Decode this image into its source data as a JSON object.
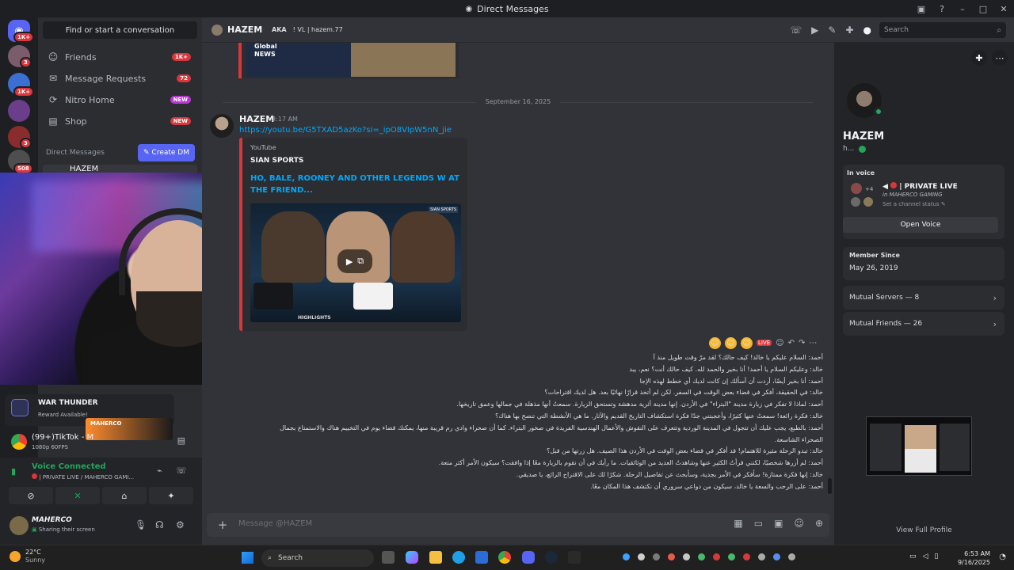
{
  "window": {
    "title": "Direct Messages"
  },
  "rail": {
    "badges": [
      "1K+",
      "3",
      "1K+",
      "3",
      "3",
      "508"
    ]
  },
  "sidebar": {
    "find_label": "Find or start a conversation",
    "items": [
      {
        "label": "Friends",
        "badge": "1K+"
      },
      {
        "label": "Message Requests",
        "badge": "72"
      },
      {
        "label": "Nitro Home",
        "badge": "NEW"
      },
      {
        "label": "Shop",
        "badge": "NEW"
      }
    ],
    "dm_header": "Direct Messages",
    "create_dm": "Create DM",
    "first_dm": "HAZEM"
  },
  "activity": {
    "game": "WAR THUNDER",
    "sub": "Reward Available!"
  },
  "tiktok": {
    "title": "(99+)TikTok - M",
    "sub": "1080p 60FPS",
    "overlay_brand": "MAHERCO"
  },
  "voice": {
    "status": "Voice Connected",
    "channel": "| PRIVATE LIVE / MAHERCO GAMI..."
  },
  "user": {
    "name": "MAHERCO",
    "status": "Sharing their screen"
  },
  "header": {
    "name": "HAZEM",
    "aka_label": "AKA",
    "aka_value": "! VL | hazem.77",
    "search_placeholder": "Search"
  },
  "chat": {
    "top_embed_text": "Global NEWS",
    "date_separator": "September 16, 2025",
    "message": {
      "author": "HAZEM",
      "time": "3:17 AM",
      "link": "https://youtu.be/G5TXAD5azKo?si=_ipO8VIpW5nN_jie",
      "embed": {
        "provider": "YouTube",
        "author": "SIAN SPORTS",
        "title": "HO, BALE, ROONEY AND OTHER LEGENDS W AT THE FRIEND...",
        "badge": "SIAN SPORTS",
        "highlights": "HIGHLIGHTS"
      }
    },
    "arabic_lines": [
      "أحمد: السلام عليكم يا خالد! كيف حالك؟ لقد مرّ وقت طويل منذ آ",
      "خالد: وعليكم السلام يا أحمد! أنا بخير والحمد لله. كيف حالك أنت؟ نعم، يبد",
      "أحمد: أنا بخير أيضًا، أردت أن أسألك إن كانت لديك أي خطط لهذه الإجا",
      "خالد: في الحقيقة، أفكر في قضاء بعض الوقت في السفر. لكن لم أتخذ قرارًا نهائيًا بعد. هل لديك اقتراحات؟",
      "أحمد: لماذا لا تفكر في زيارة مدينة \"البتراء\" في الأردن. إنها مدينة أثرية مدهشة وتستحق الزيارة. سمعتُ أنها مذهلة في جمالها وعمق تاريخها.",
      "خالد: فكرة رائعة! سمعتُ عنها كثيرًا، وأعجبتني جدًا فكرة استكشاف التاريخ القديم والآثار. ما هي الأنشطة التي تنصح بها هناك؟",
      "أحمد: بالطبع، يجب عليك أن تتجول في المدينة الوردية وتتعرف على النقوش والأعمال الهندسية الفريدة في صخور البتراء. كما أن صحراء وادي رم قريبة منها، يمكنك قضاء يوم في التخييم هناك والاستمتاع بجمال",
      "الصحراء الشاسعة.",
      "خالد: تبدو الرحلة مثيرة للاهتمام! قد أفكر في قضاء بعض الوقت في الأردن هذا الصيف. هل زرتها من قبل؟",
      "أحمد: لم أزرها شخصيًا، لكنني قرأتُ الكثير عنها وشاهدتُ العديد من الوثائقيات. ما رأيك في أن نقوم بالزيارة معًا إذا وافقت؟ سيكون الأمر أكثر متعة.",
      "خالد: إنها فكرة ممتازة! سأفكر في الأمر بجدية، وسأبحث عن تفاصيل الرحلة. شكرًا لك على الاقتراح الرائع، يا صديقي.",
      "أحمد: على الرحب والسعة يا خالد، سيكون من دواعي سروري أن نكتشف هذا المكان معًا."
    ],
    "composer_placeholder": "Message @HAZEM"
  },
  "profile": {
    "name": "HAZEM",
    "username": "h...",
    "in_voice_label": "In voice",
    "voice_count": "+4",
    "voice_channel": "| PRIVATE LIVE",
    "voice_server": "in MAHERCO GAMING",
    "channel_status": "Set a channel status",
    "open_voice": "Open Voice",
    "member_since_label": "Member Since",
    "member_since": "May 26, 2019",
    "mutual_servers": "Mutual Servers — 8",
    "mutual_friends": "Mutual Friends — 26",
    "view_full": "View Full Profile"
  },
  "taskbar": {
    "temp": "22°C",
    "cond": "Sunny",
    "search": "Search",
    "time": "6:53 AM",
    "date": "9/16/2025"
  }
}
